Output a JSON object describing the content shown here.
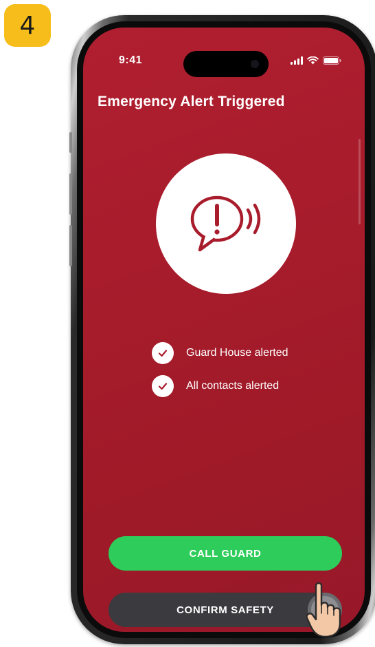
{
  "step": {
    "number": "4",
    "color": "#f7be1b"
  },
  "status_bar": {
    "time": "9:41"
  },
  "screen": {
    "title": "Emergency Alert Triggered",
    "background": "#a81c2c",
    "alert_icon": "alert-speech-bubble-icon",
    "statuses": [
      {
        "label": "Guard House alerted",
        "icon": "check-icon"
      },
      {
        "label": "All contacts alerted",
        "icon": "check-icon"
      }
    ],
    "buttons": {
      "call_guard": {
        "label": "CALL GUARD",
        "color": "#2ecc5a"
      },
      "confirm_safety": {
        "label": "CONFIRM SAFETY",
        "color": "#3a3a3f"
      }
    }
  }
}
